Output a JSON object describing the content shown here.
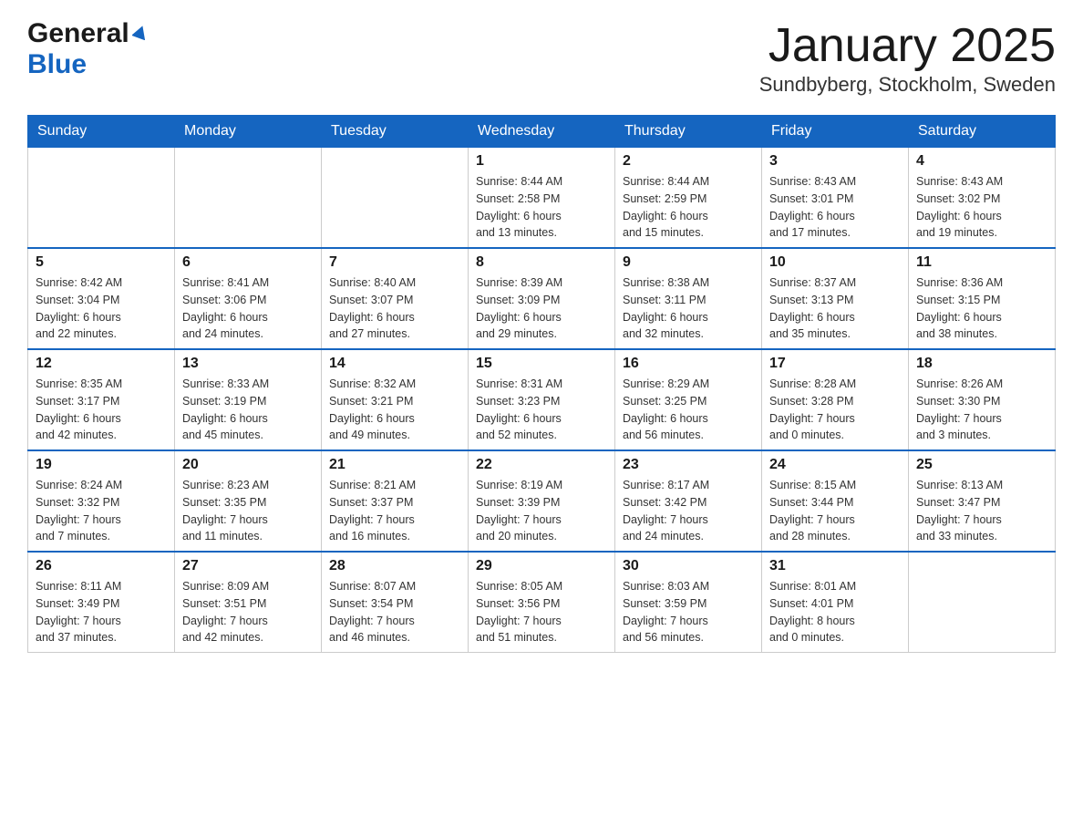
{
  "header": {
    "logo_general": "General",
    "logo_blue": "Blue",
    "month_title": "January 2025",
    "location": "Sundbyberg, Stockholm, Sweden"
  },
  "calendar": {
    "days_of_week": [
      "Sunday",
      "Monday",
      "Tuesday",
      "Wednesday",
      "Thursday",
      "Friday",
      "Saturday"
    ],
    "weeks": [
      {
        "cells": [
          {
            "day": "",
            "info": ""
          },
          {
            "day": "",
            "info": ""
          },
          {
            "day": "",
            "info": ""
          },
          {
            "day": "1",
            "info": "Sunrise: 8:44 AM\nSunset: 2:58 PM\nDaylight: 6 hours\nand 13 minutes."
          },
          {
            "day": "2",
            "info": "Sunrise: 8:44 AM\nSunset: 2:59 PM\nDaylight: 6 hours\nand 15 minutes."
          },
          {
            "day": "3",
            "info": "Sunrise: 8:43 AM\nSunset: 3:01 PM\nDaylight: 6 hours\nand 17 minutes."
          },
          {
            "day": "4",
            "info": "Sunrise: 8:43 AM\nSunset: 3:02 PM\nDaylight: 6 hours\nand 19 minutes."
          }
        ]
      },
      {
        "cells": [
          {
            "day": "5",
            "info": "Sunrise: 8:42 AM\nSunset: 3:04 PM\nDaylight: 6 hours\nand 22 minutes."
          },
          {
            "day": "6",
            "info": "Sunrise: 8:41 AM\nSunset: 3:06 PM\nDaylight: 6 hours\nand 24 minutes."
          },
          {
            "day": "7",
            "info": "Sunrise: 8:40 AM\nSunset: 3:07 PM\nDaylight: 6 hours\nand 27 minutes."
          },
          {
            "day": "8",
            "info": "Sunrise: 8:39 AM\nSunset: 3:09 PM\nDaylight: 6 hours\nand 29 minutes."
          },
          {
            "day": "9",
            "info": "Sunrise: 8:38 AM\nSunset: 3:11 PM\nDaylight: 6 hours\nand 32 minutes."
          },
          {
            "day": "10",
            "info": "Sunrise: 8:37 AM\nSunset: 3:13 PM\nDaylight: 6 hours\nand 35 minutes."
          },
          {
            "day": "11",
            "info": "Sunrise: 8:36 AM\nSunset: 3:15 PM\nDaylight: 6 hours\nand 38 minutes."
          }
        ]
      },
      {
        "cells": [
          {
            "day": "12",
            "info": "Sunrise: 8:35 AM\nSunset: 3:17 PM\nDaylight: 6 hours\nand 42 minutes."
          },
          {
            "day": "13",
            "info": "Sunrise: 8:33 AM\nSunset: 3:19 PM\nDaylight: 6 hours\nand 45 minutes."
          },
          {
            "day": "14",
            "info": "Sunrise: 8:32 AM\nSunset: 3:21 PM\nDaylight: 6 hours\nand 49 minutes."
          },
          {
            "day": "15",
            "info": "Sunrise: 8:31 AM\nSunset: 3:23 PM\nDaylight: 6 hours\nand 52 minutes."
          },
          {
            "day": "16",
            "info": "Sunrise: 8:29 AM\nSunset: 3:25 PM\nDaylight: 6 hours\nand 56 minutes."
          },
          {
            "day": "17",
            "info": "Sunrise: 8:28 AM\nSunset: 3:28 PM\nDaylight: 7 hours\nand 0 minutes."
          },
          {
            "day": "18",
            "info": "Sunrise: 8:26 AM\nSunset: 3:30 PM\nDaylight: 7 hours\nand 3 minutes."
          }
        ]
      },
      {
        "cells": [
          {
            "day": "19",
            "info": "Sunrise: 8:24 AM\nSunset: 3:32 PM\nDaylight: 7 hours\nand 7 minutes."
          },
          {
            "day": "20",
            "info": "Sunrise: 8:23 AM\nSunset: 3:35 PM\nDaylight: 7 hours\nand 11 minutes."
          },
          {
            "day": "21",
            "info": "Sunrise: 8:21 AM\nSunset: 3:37 PM\nDaylight: 7 hours\nand 16 minutes."
          },
          {
            "day": "22",
            "info": "Sunrise: 8:19 AM\nSunset: 3:39 PM\nDaylight: 7 hours\nand 20 minutes."
          },
          {
            "day": "23",
            "info": "Sunrise: 8:17 AM\nSunset: 3:42 PM\nDaylight: 7 hours\nand 24 minutes."
          },
          {
            "day": "24",
            "info": "Sunrise: 8:15 AM\nSunset: 3:44 PM\nDaylight: 7 hours\nand 28 minutes."
          },
          {
            "day": "25",
            "info": "Sunrise: 8:13 AM\nSunset: 3:47 PM\nDaylight: 7 hours\nand 33 minutes."
          }
        ]
      },
      {
        "cells": [
          {
            "day": "26",
            "info": "Sunrise: 8:11 AM\nSunset: 3:49 PM\nDaylight: 7 hours\nand 37 minutes."
          },
          {
            "day": "27",
            "info": "Sunrise: 8:09 AM\nSunset: 3:51 PM\nDaylight: 7 hours\nand 42 minutes."
          },
          {
            "day": "28",
            "info": "Sunrise: 8:07 AM\nSunset: 3:54 PM\nDaylight: 7 hours\nand 46 minutes."
          },
          {
            "day": "29",
            "info": "Sunrise: 8:05 AM\nSunset: 3:56 PM\nDaylight: 7 hours\nand 51 minutes."
          },
          {
            "day": "30",
            "info": "Sunrise: 8:03 AM\nSunset: 3:59 PM\nDaylight: 7 hours\nand 56 minutes."
          },
          {
            "day": "31",
            "info": "Sunrise: 8:01 AM\nSunset: 4:01 PM\nDaylight: 8 hours\nand 0 minutes."
          },
          {
            "day": "",
            "info": ""
          }
        ]
      }
    ]
  }
}
